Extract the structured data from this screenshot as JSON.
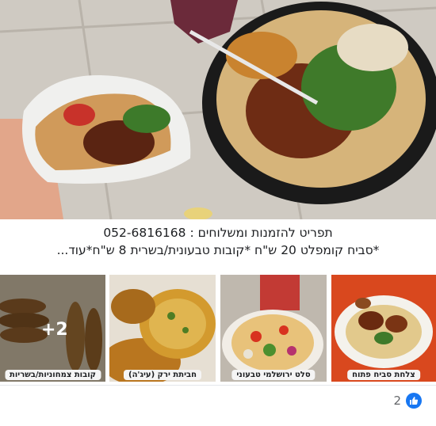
{
  "post": {
    "caption_line1": "תפריט להזמנות ומשלוחים : 052-6816168",
    "caption_line2": "*סביח קומפלט 20 ש\"ח *קובות טבעונית/בשרית 8 ש\"ח*עוד..."
  },
  "gallery": {
    "items": [
      {
        "label": "צלחת סביח פתוח"
      },
      {
        "label": "סלט ירושלמי טבעוני"
      },
      {
        "label": "חביתת ירק (עיג'ה)"
      },
      {
        "label": "קובות צמחוניות/בשריות"
      }
    ],
    "more_count": "+2"
  },
  "reactions": {
    "count": "2",
    "icon": "like-icon",
    "accent": "#1877f2"
  }
}
